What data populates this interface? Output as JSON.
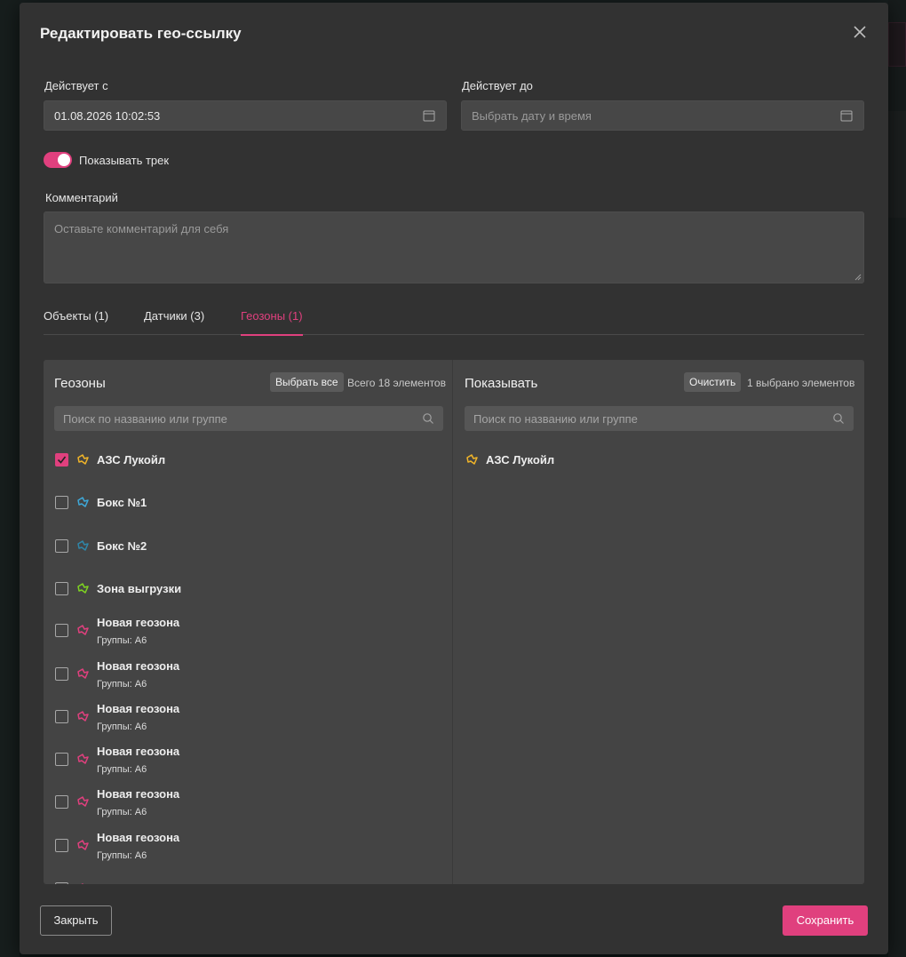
{
  "modal": {
    "title": "Редактировать гео-ссылку"
  },
  "fields": {
    "valid_from_label": "Действует с",
    "valid_from_value": "01.08.2026 10:02:53",
    "valid_to_label": "Действует до",
    "valid_to_placeholder": "Выбрать дату и время",
    "show_track_label": "Показывать трек",
    "show_track_on": true,
    "comment_label": "Комментарий",
    "comment_placeholder": "Оставьте комментарий для себя"
  },
  "tabs": [
    {
      "label": "Объекты (1)",
      "active": false
    },
    {
      "label": "Датчики (3)",
      "active": false
    },
    {
      "label": "Геозоны (1)",
      "active": true
    }
  ],
  "left_panel": {
    "title": "Геозоны",
    "select_all_label": "Выбрать все",
    "total_text": "Всего 18 элементов",
    "search_placeholder": "Поиск по названию или группе",
    "items": [
      {
        "name": "АЗС Лукойл",
        "group": "",
        "checked": true,
        "icon_color": "#f0b429"
      },
      {
        "name": "Бокс №1",
        "group": "",
        "checked": false,
        "icon_color": "#3ea8d8"
      },
      {
        "name": "Бокс №2",
        "group": "",
        "checked": false,
        "icon_color": "#2f86a8"
      },
      {
        "name": "Зона выгрузки",
        "group": "",
        "checked": false,
        "icon_color": "#7ed321"
      },
      {
        "name": "Новая геозона",
        "group": "Группы: А6",
        "checked": false,
        "icon_color": "#e0407e"
      },
      {
        "name": "Новая геозона",
        "group": "Группы: А6",
        "checked": false,
        "icon_color": "#e0407e"
      },
      {
        "name": "Новая геозона",
        "group": "Группы: А6",
        "checked": false,
        "icon_color": "#e0407e"
      },
      {
        "name": "Новая геозона",
        "group": "Группы: А6",
        "checked": false,
        "icon_color": "#e0407e"
      },
      {
        "name": "Новая геозона",
        "group": "Группы: А6",
        "checked": false,
        "icon_color": "#e0407e"
      },
      {
        "name": "Новая геозона",
        "group": "Группы: А6",
        "checked": false,
        "icon_color": "#e0407e"
      },
      {
        "name": "Новая геозона",
        "group": "",
        "checked": false,
        "icon_color": "#e0407e"
      }
    ]
  },
  "right_panel": {
    "title": "Показывать",
    "clear_label": "Очистить",
    "selected_text": "1 выбрано элементов",
    "search_placeholder": "Поиск по названию или группе",
    "items": [
      {
        "name": "АЗС Лукойл",
        "icon_color": "#f0b429"
      }
    ]
  },
  "footer": {
    "close_label": "Закрыть",
    "save_label": "Сохранить"
  },
  "colors": {
    "accent": "#e0407e"
  }
}
